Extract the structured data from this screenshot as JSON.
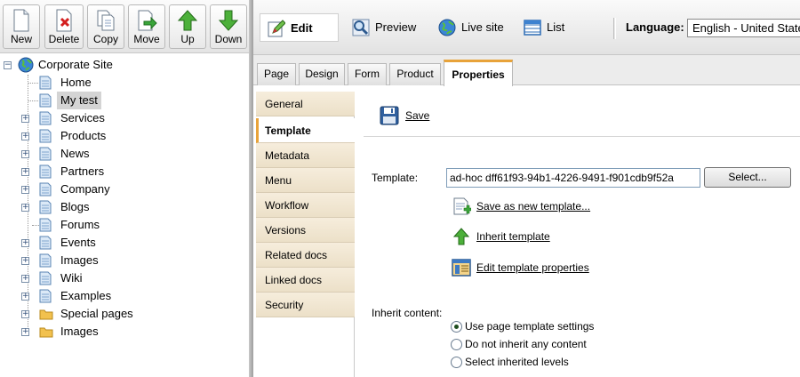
{
  "toolbar": {
    "buttons": [
      {
        "label": "New",
        "icon": "new-document-icon"
      },
      {
        "label": "Delete",
        "icon": "delete-document-icon"
      },
      {
        "label": "Copy",
        "icon": "copy-documents-icon"
      },
      {
        "label": "Move",
        "icon": "move-document-icon"
      },
      {
        "label": "Up",
        "icon": "arrow-up-icon"
      },
      {
        "label": "Down",
        "icon": "arrow-down-icon"
      }
    ]
  },
  "tree": {
    "root": "Corporate Site",
    "items": [
      "Home",
      "My test",
      "Services",
      "Products",
      "News",
      "Partners",
      "Company",
      "Blogs",
      "Forums",
      "Events",
      "Images",
      "Wiki",
      "Examples",
      "Special pages",
      "Images"
    ],
    "selected": "My test"
  },
  "modes": {
    "edit": "Edit",
    "preview": "Preview",
    "live_site": "Live site",
    "list": "List"
  },
  "language": {
    "label": "Language:",
    "value": "English - United States"
  },
  "tabs": [
    "Page",
    "Design",
    "Form",
    "Product",
    "Properties"
  ],
  "active_tab": "Properties",
  "vertical_tabs": [
    "General",
    "Template",
    "Metadata",
    "Menu",
    "Workflow",
    "Versions",
    "Related docs",
    "Linked docs",
    "Security"
  ],
  "active_vertical_tab": "Template",
  "content": {
    "save_label": "Save",
    "template_label": "Template:",
    "template_value": "ad-hoc dff61f93-94b1-4226-9491-f901cdb9f52a",
    "select_button": "Select...",
    "links": [
      "Save as new template...",
      "Inherit template",
      "Edit template properties"
    ],
    "inherit_label": "Inherit content:",
    "radio_options": [
      "Use page template settings",
      "Do not inherit any content",
      "Select inherited levels"
    ],
    "radio_selected": "Use page template settings"
  },
  "colors": {
    "accent": "#e8a33a",
    "vertical_tab_bg": "#f1e6d0",
    "selected_tree_bg": "#d4d4d4"
  }
}
